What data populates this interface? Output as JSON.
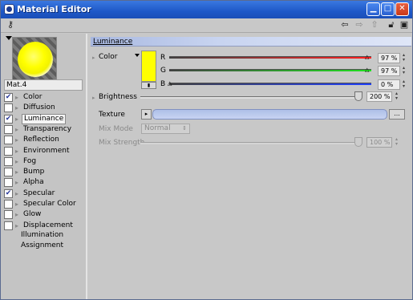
{
  "window": {
    "title": "Material Editor",
    "icons": [
      "app-icon",
      "minimize-icon",
      "maximize-icon",
      "close-icon"
    ]
  },
  "toolbar": {
    "icons": [
      "key-icon",
      "back-arrow-icon",
      "forward-arrow-icon",
      "up-arrow-icon",
      "lock-icon",
      "new-window-icon"
    ]
  },
  "material": {
    "name": "Mat.4"
  },
  "channels": [
    {
      "label": "Color",
      "checked": true,
      "selected": false
    },
    {
      "label": "Diffusion",
      "checked": false,
      "selected": false
    },
    {
      "label": "Luminance",
      "checked": true,
      "selected": true
    },
    {
      "label": "Transparency",
      "checked": false,
      "selected": false
    },
    {
      "label": "Reflection",
      "checked": false,
      "selected": false
    },
    {
      "label": "Environment",
      "checked": false,
      "selected": false
    },
    {
      "label": "Fog",
      "checked": false,
      "selected": false
    },
    {
      "label": "Bump",
      "checked": false,
      "selected": false
    },
    {
      "label": "Alpha",
      "checked": false,
      "selected": false
    },
    {
      "label": "Specular",
      "checked": true,
      "selected": false
    },
    {
      "label": "Specular Color",
      "checked": false,
      "selected": false
    },
    {
      "label": "Glow",
      "checked": false,
      "selected": false
    },
    {
      "label": "Displacement",
      "checked": false,
      "selected": false
    }
  ],
  "extra_items": [
    "Illumination",
    "Assignment"
  ],
  "section": {
    "title": "Luminance"
  },
  "color": {
    "label": "Color",
    "swatch": "#ffff00",
    "r_label": "R",
    "g_label": "G",
    "b_label": "B",
    "r_value": "97 %",
    "g_value": "97 %",
    "b_value": "0 %"
  },
  "brightness": {
    "label": "Brightness",
    "value": "200 %"
  },
  "texture": {
    "label": "Texture",
    "more_label": "..."
  },
  "mix_mode": {
    "label": "Mix Mode",
    "selected": "Normal"
  },
  "mix_strength": {
    "label": "Mix Strength",
    "value": "100 %"
  }
}
